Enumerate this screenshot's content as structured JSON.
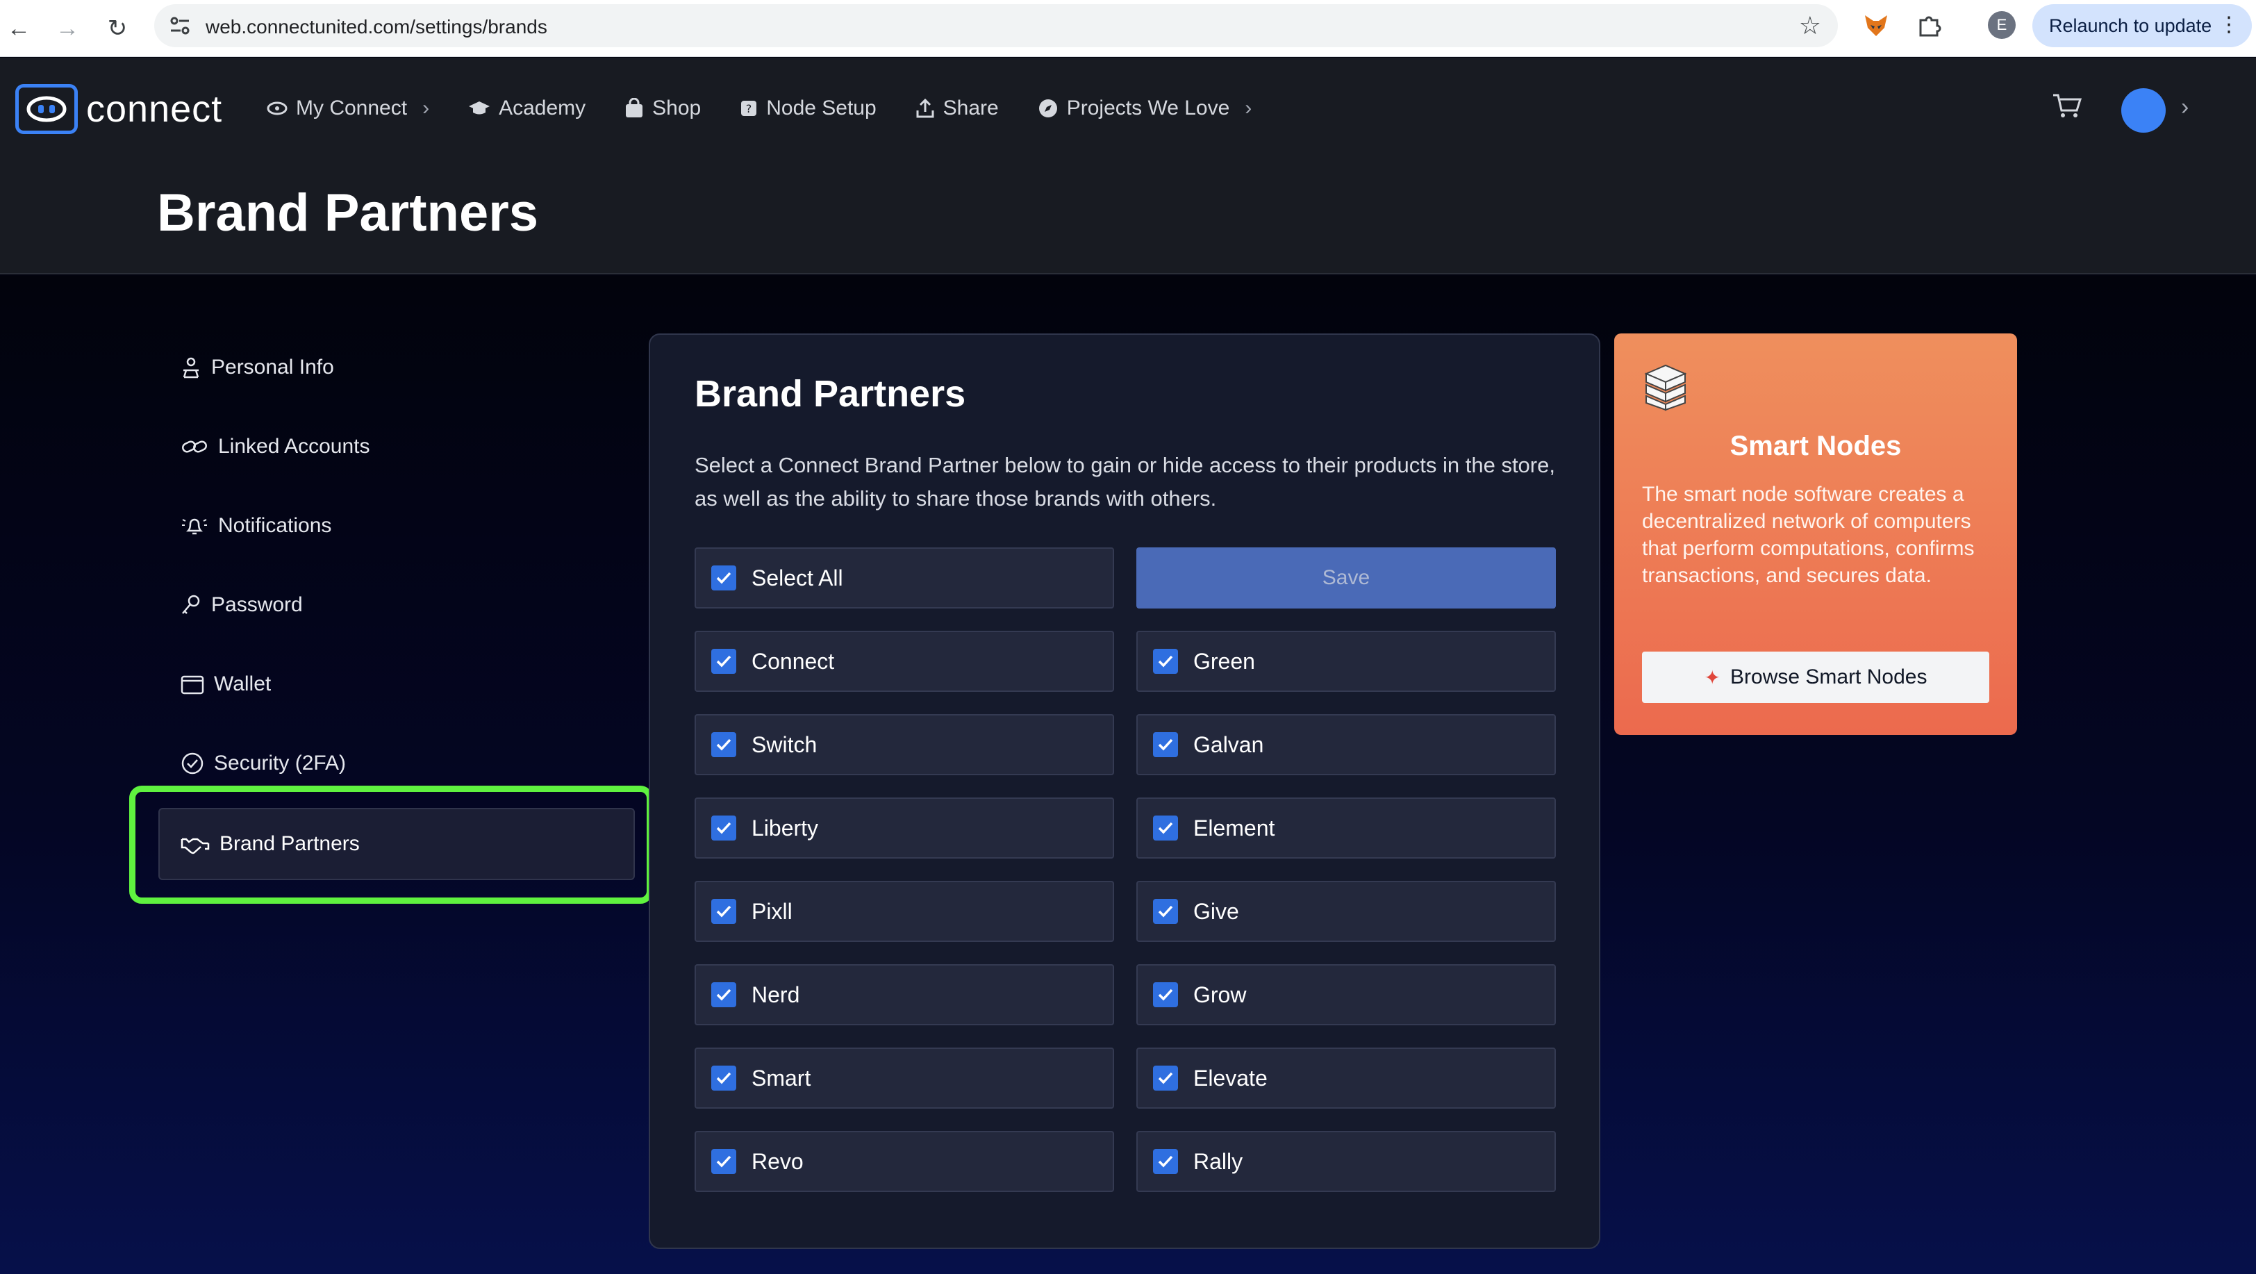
{
  "browser": {
    "url": "web.connectunited.com/settings/brands",
    "profile_initial": "E",
    "relaunch_label": "Relaunch to update"
  },
  "header": {
    "logo_text": "connect",
    "nav": [
      {
        "label": "My Connect",
        "icon": "eye-icon",
        "has_chevron": true
      },
      {
        "label": "Academy",
        "icon": "graduation-cap-icon",
        "has_chevron": false
      },
      {
        "label": "Shop",
        "icon": "shopping-bag-icon",
        "has_chevron": false
      },
      {
        "label": "Node Setup",
        "icon": "node-icon",
        "has_chevron": false
      },
      {
        "label": "Share",
        "icon": "share-icon",
        "has_chevron": false
      },
      {
        "label": "Projects We Love",
        "icon": "compass-icon",
        "has_chevron": true
      }
    ],
    "page_title": "Brand Partners",
    "avatar_color": "#3b82f6"
  },
  "sidebar": {
    "items": [
      {
        "label": "Personal Info",
        "icon": "person-icon"
      },
      {
        "label": "Linked Accounts",
        "icon": "link-icon"
      },
      {
        "label": "Notifications",
        "icon": "bell-icon"
      },
      {
        "label": "Password",
        "icon": "key-icon"
      },
      {
        "label": "Wallet",
        "icon": "wallet-icon"
      },
      {
        "label": "Security (2FA)",
        "icon": "check-circle-icon"
      },
      {
        "label": "Brand Partners",
        "icon": "handshake-icon",
        "active": true
      }
    ],
    "highlight_color": "#5ff23f"
  },
  "panel": {
    "title": "Brand Partners",
    "description": "Select a Connect Brand Partner below to gain or hide access to their products in the store, as well as the ability to share those brands with others.",
    "select_all_label": "Select All",
    "select_all_checked": true,
    "save_label": "Save",
    "brands_left": [
      {
        "label": "Connect",
        "checked": true
      },
      {
        "label": "Switch",
        "checked": true
      },
      {
        "label": "Liberty",
        "checked": true
      },
      {
        "label": "Pixll",
        "checked": true
      },
      {
        "label": "Nerd",
        "checked": true
      },
      {
        "label": "Smart",
        "checked": true
      },
      {
        "label": "Revo",
        "checked": true
      }
    ],
    "brands_right": [
      {
        "label": "Green",
        "checked": true
      },
      {
        "label": "Galvan",
        "checked": true
      },
      {
        "label": "Element",
        "checked": true
      },
      {
        "label": "Give",
        "checked": true
      },
      {
        "label": "Grow",
        "checked": true
      },
      {
        "label": "Elevate",
        "checked": true
      },
      {
        "label": "Rally",
        "checked": true
      }
    ],
    "checkbox_color": "#2f6fe0"
  },
  "promo": {
    "title": "Smart Nodes",
    "text": "The smart node software creates a decentralized network of computers that perform computations, confirms transactions, and secures data.",
    "button_label": "Browse Smart Nodes",
    "icon": "server-stack-icon"
  }
}
